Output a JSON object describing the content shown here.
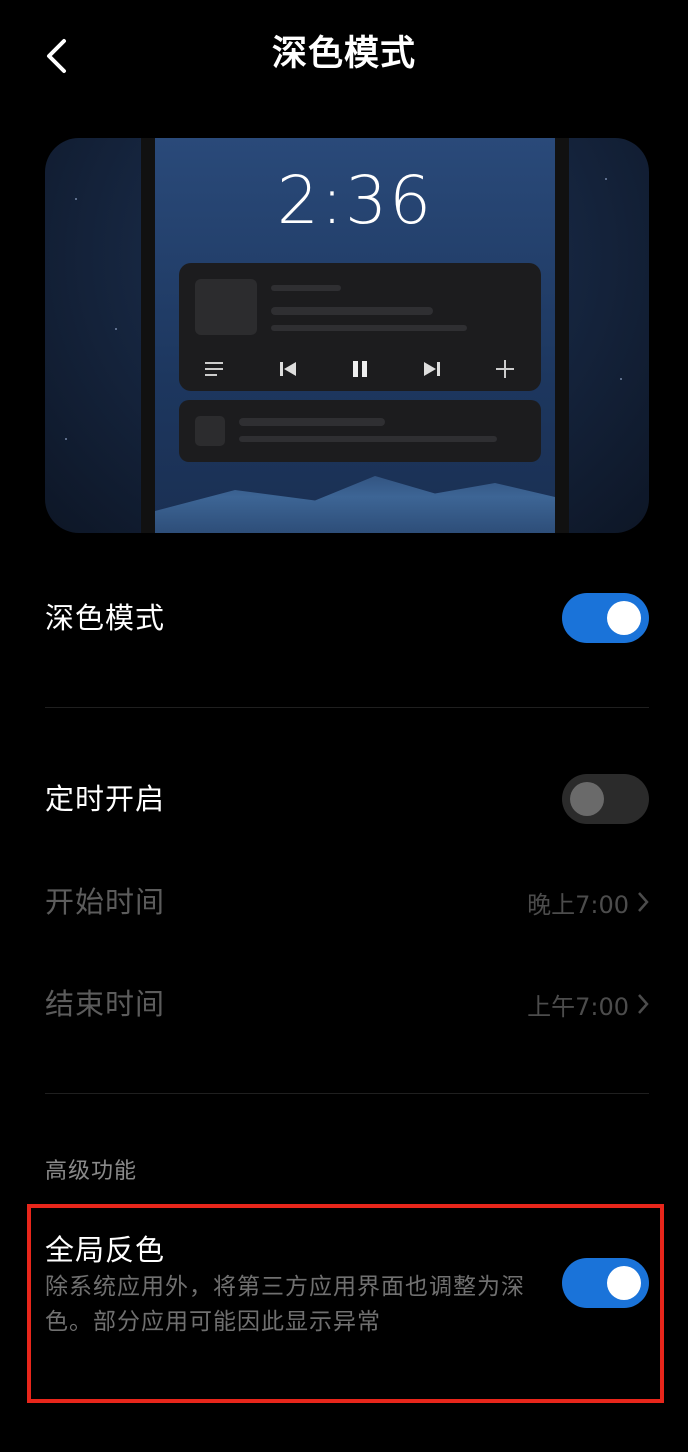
{
  "header": {
    "title": "深色模式",
    "back_icon": "chevron-left-icon"
  },
  "preview": {
    "clock": "2:36",
    "controls": [
      "playlist-icon",
      "skip-previous-icon",
      "pause-icon",
      "skip-next-icon",
      "plus-icon"
    ]
  },
  "settings": {
    "dark_mode": {
      "label": "深色模式",
      "enabled": true
    },
    "scheduled": {
      "label": "定时开启",
      "enabled": false
    },
    "start_time": {
      "label": "开始时间",
      "value": "晚上7:00"
    },
    "end_time": {
      "label": "结束时间",
      "value": "上午7:00"
    }
  },
  "advanced": {
    "section_title": "高级功能",
    "global_invert": {
      "label": "全局反色",
      "description": "除系统应用外，将第三方应用界面也调整为深色。部分应用可能因此显示异常",
      "enabled": true
    }
  },
  "colors": {
    "accent": "#1a73d9",
    "highlight": "#e8261b",
    "background": "#000000"
  }
}
